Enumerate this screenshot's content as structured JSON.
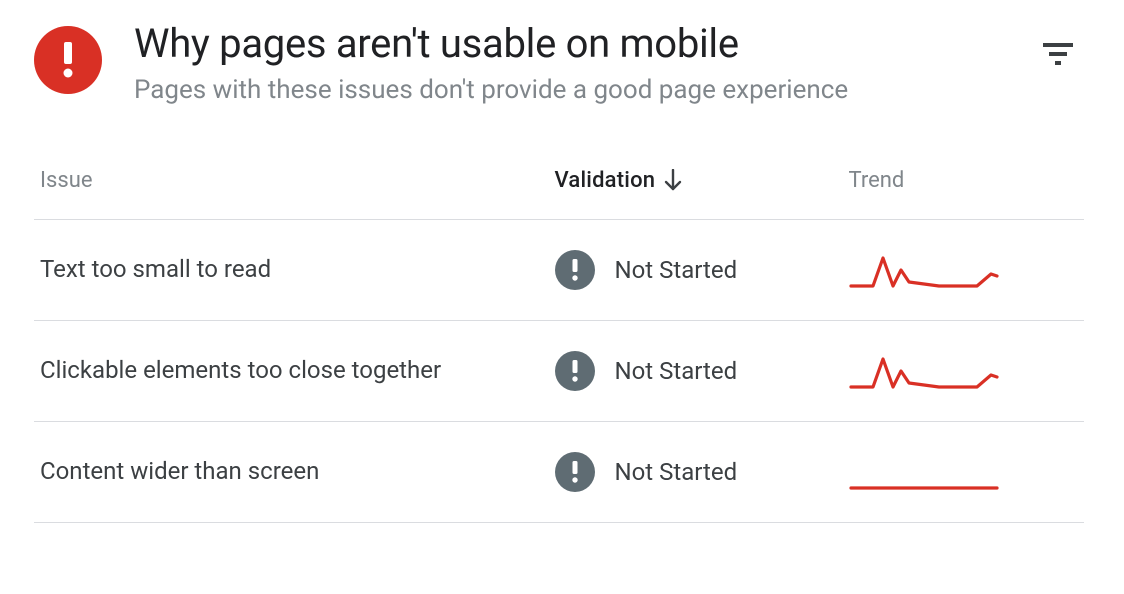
{
  "header": {
    "title": "Why pages aren't usable on mobile",
    "subtitle": "Pages with these issues don't provide a good page experience"
  },
  "columns": {
    "issue": "Issue",
    "validation": "Validation",
    "trend": "Trend"
  },
  "status_label": "Not Started",
  "rows": [
    {
      "issue": "Text too small to read",
      "validation": "Not Started",
      "trend": "spike"
    },
    {
      "issue": "Clickable elements too close together",
      "validation": "Not Started",
      "trend": "spike"
    },
    {
      "issue": "Content wider than screen",
      "validation": "Not Started",
      "trend": "flat"
    }
  ],
  "colors": {
    "error": "#d93025",
    "status_badge": "#5f6c73",
    "trend": "#d93025"
  }
}
